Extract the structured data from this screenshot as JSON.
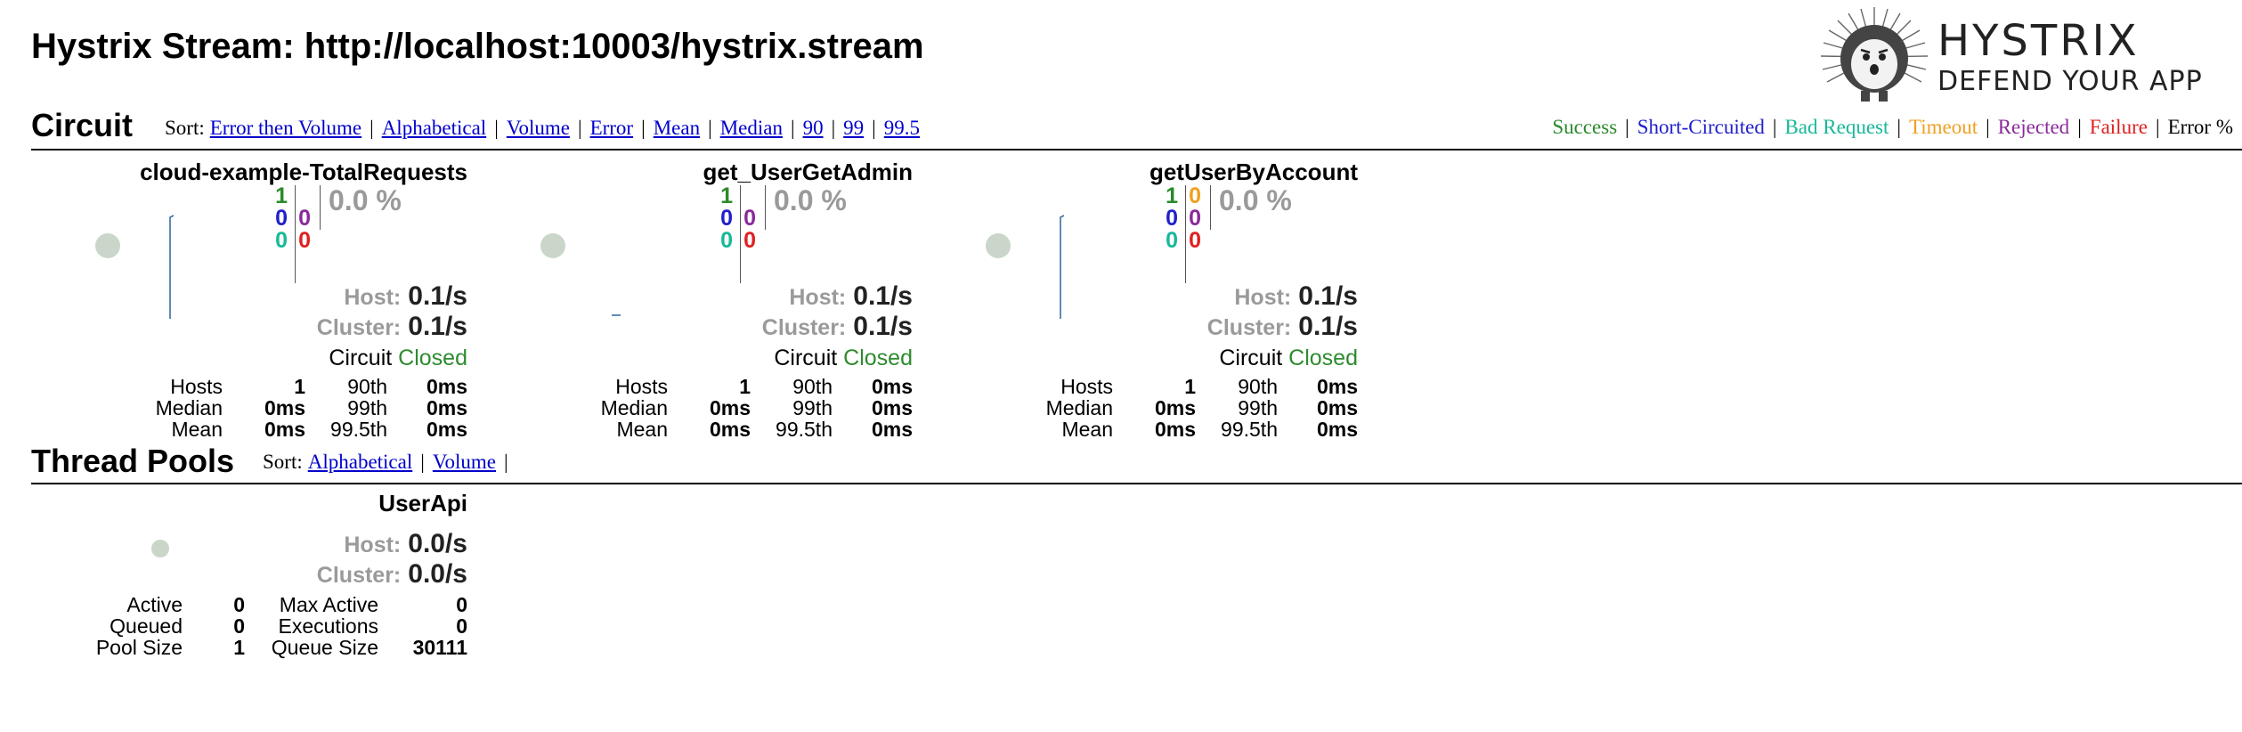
{
  "page": {
    "title": "Hystrix Stream: http://localhost:10003/hystrix.stream"
  },
  "logo": {
    "brand": "HYSTRIX",
    "tagline": "DEFEND YOUR APP"
  },
  "circuit_section": {
    "title": "Circuit",
    "sort_label": "Sort:",
    "sort_options": [
      "Error then Volume",
      "Alphabetical",
      "Volume",
      "Error",
      "Mean",
      "Median",
      "90",
      "99",
      "99.5"
    ]
  },
  "legend": {
    "items": [
      "Success",
      "Short-Circuited",
      "Bad Request",
      "Timeout",
      "Rejected",
      "Failure",
      "Error %"
    ]
  },
  "colors": {
    "success": "#2a8a2a",
    "short_circuited": "#2020cc",
    "bad_request": "#17b89a",
    "timeout": "#f0a020",
    "rejected": "#8a2a9a",
    "failure": "#e02020",
    "link": "#0000cc",
    "status_closed": "#2e8b2e"
  },
  "circuits": [
    {
      "name": "cloud-example-TotalRequests",
      "success": "1",
      "short_circuited": "0",
      "bad_request": "0",
      "timeout": "",
      "rejected": "0",
      "failure": "0",
      "error_pct": "0.0 %",
      "host_label": "Host:",
      "host_rate": "0.1/s",
      "cluster_label": "Cluster:",
      "cluster_rate": "0.1/s",
      "circuit_label": "Circuit",
      "circuit_status": "Closed",
      "stats_left_labels": [
        "Hosts",
        "Median",
        "Mean"
      ],
      "stats_left_values": [
        "1",
        "0ms",
        "0ms"
      ],
      "stats_right_labels": [
        "90th",
        "99th",
        "99.5th"
      ],
      "stats_right_values": [
        "0ms",
        "0ms",
        "0ms"
      ]
    },
    {
      "name": "get_UserGetAdmin",
      "success": "1",
      "short_circuited": "0",
      "bad_request": "0",
      "timeout": "",
      "rejected": "0",
      "failure": "0",
      "error_pct": "0.0 %",
      "host_label": "Host:",
      "host_rate": "0.1/s",
      "cluster_label": "Cluster:",
      "cluster_rate": "0.1/s",
      "circuit_label": "Circuit",
      "circuit_status": "Closed",
      "stats_left_labels": [
        "Hosts",
        "Median",
        "Mean"
      ],
      "stats_left_values": [
        "1",
        "0ms",
        "0ms"
      ],
      "stats_right_labels": [
        "90th",
        "99th",
        "99.5th"
      ],
      "stats_right_values": [
        "0ms",
        "0ms",
        "0ms"
      ]
    },
    {
      "name": "getUserByAccount",
      "success": "1",
      "short_circuited": "0",
      "bad_request": "0",
      "timeout": "0",
      "rejected": "0",
      "failure": "0",
      "error_pct": "0.0 %",
      "host_label": "Host:",
      "host_rate": "0.1/s",
      "cluster_label": "Cluster:",
      "cluster_rate": "0.1/s",
      "circuit_label": "Circuit",
      "circuit_status": "Closed",
      "stats_left_labels": [
        "Hosts",
        "Median",
        "Mean"
      ],
      "stats_left_values": [
        "1",
        "0ms",
        "0ms"
      ],
      "stats_right_labels": [
        "90th",
        "99th",
        "99.5th"
      ],
      "stats_right_values": [
        "0ms",
        "0ms",
        "0ms"
      ]
    }
  ],
  "thread_pool_section": {
    "title": "Thread Pools",
    "sort_label": "Sort:",
    "sort_options": [
      "Alphabetical",
      "Volume"
    ]
  },
  "thread_pools": [
    {
      "name": "UserApi",
      "host_label": "Host:",
      "host_rate": "0.0/s",
      "cluster_label": "Cluster:",
      "cluster_rate": "0.0/s",
      "left_labels": [
        "Active",
        "Queued",
        "Pool Size"
      ],
      "left_values": [
        "0",
        "0",
        "1"
      ],
      "right_labels": [
        "Max Active",
        "Executions",
        "Queue Size"
      ],
      "right_values": [
        "0",
        "0",
        "30111"
      ]
    }
  ]
}
